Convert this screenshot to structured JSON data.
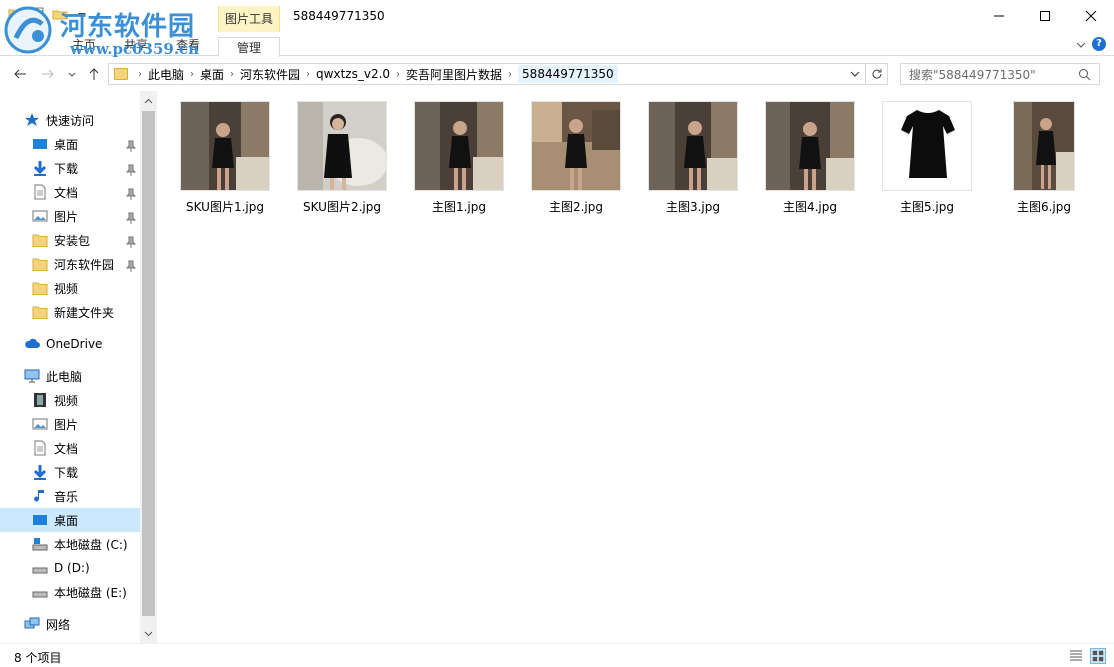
{
  "window": {
    "title": "588449771350",
    "ribbon_context_tab": "图片工具",
    "ribbon_tabs": [
      "文件",
      "主页",
      "共享",
      "查看"
    ],
    "ribbon_manage": "管理",
    "controls": {
      "minimize": "minimize",
      "maximize": "maximize",
      "close": "close"
    }
  },
  "watermark": {
    "title": "河东软件园",
    "url": "www.pc0359.cn"
  },
  "address": {
    "crumbs": [
      "此电脑",
      "桌面",
      "河东软件园",
      "qwxtzs_v2.0",
      "奕吾阿里图片数据",
      "588449771350"
    ]
  },
  "search": {
    "placeholder": "搜索\"588449771350\""
  },
  "sidebar": {
    "quick_access": "快速访问",
    "quick_items": [
      "桌面",
      "下载",
      "文档",
      "图片",
      "安装包",
      "河东软件园",
      "视频",
      "新建文件夹"
    ],
    "onedrive": "OneDrive",
    "this_pc": "此电脑",
    "pc_items": [
      "视频",
      "图片",
      "文档",
      "下载",
      "音乐",
      "桌面",
      "本地磁盘 (C:)",
      "D (D:)",
      "本地磁盘 (E:)"
    ],
    "network": "网络"
  },
  "files": [
    {
      "name": "SKU图片1.jpg",
      "kind": "photo-room"
    },
    {
      "name": "SKU图片2.jpg",
      "kind": "photo-studio"
    },
    {
      "name": "主图1.jpg",
      "kind": "photo-room"
    },
    {
      "name": "主图2.jpg",
      "kind": "photo-bright"
    },
    {
      "name": "主图3.jpg",
      "kind": "photo-room"
    },
    {
      "name": "主图4.jpg",
      "kind": "photo-room"
    },
    {
      "name": "主图5.jpg",
      "kind": "product-dress"
    },
    {
      "name": "主图6.jpg",
      "kind": "photo-narrow"
    }
  ],
  "status": {
    "count": "8 个项目"
  },
  "colors": {
    "selected": "#cce8ff",
    "accent": "#1e6fd0",
    "folder": "#f5d57a",
    "ribbon_tools": "#fdf3c4"
  }
}
